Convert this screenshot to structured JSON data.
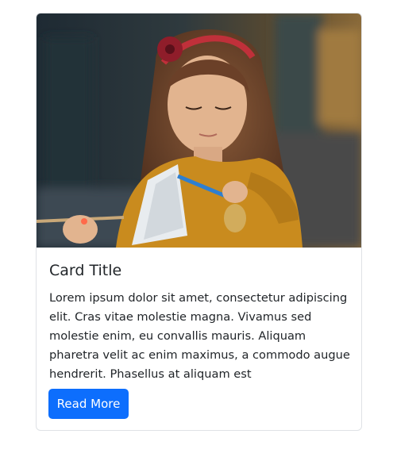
{
  "card": {
    "image": {
      "subject": "girl-painting-photo",
      "colors": {
        "background_dark": "#1e2a33",
        "background_warm": "#8a6a3a",
        "shirt": "#c98b1e",
        "hair": "#6b4028",
        "skin": "#e2b48f",
        "headband": "#c0303a"
      }
    },
    "title": "Card Title",
    "text": "Lorem ipsum dolor sit amet, consectetur adipiscing elit. Cras vitae molestie magna. Vivamus sed molestie enim, eu convallis mauris. Aliquam pharetra velit ac enim maximus, a commodo augue hendrerit. Phasellus at aliquam est",
    "button_label": "Read More",
    "accent_color": "#0d6efd"
  }
}
